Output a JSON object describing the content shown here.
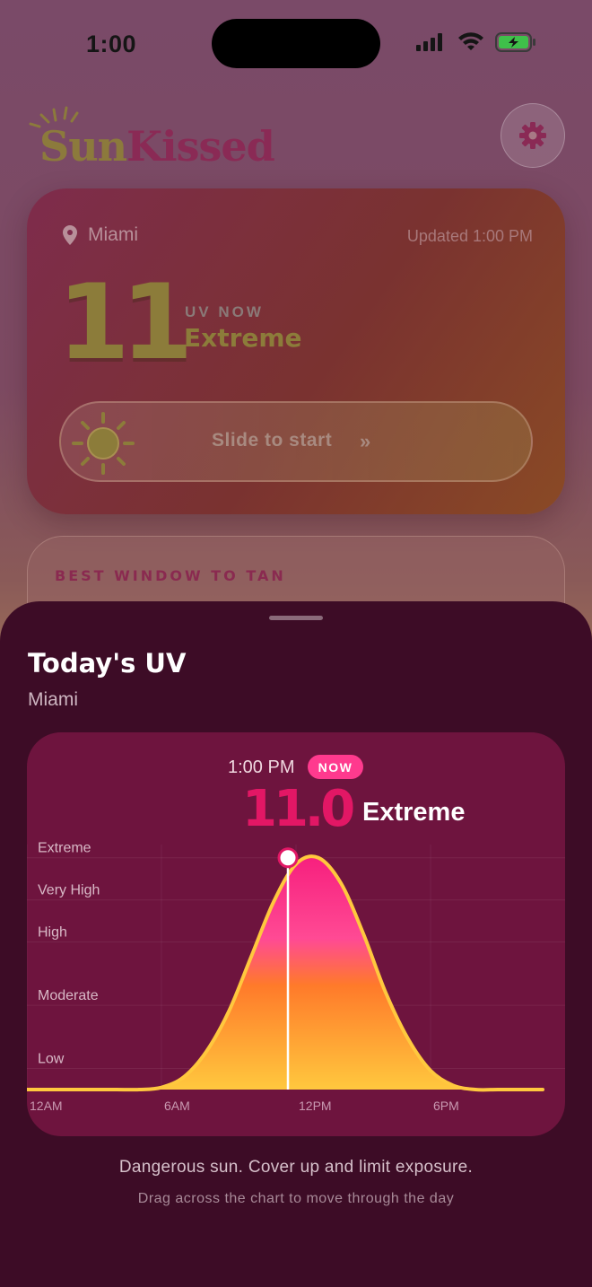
{
  "status_bar": {
    "time": "1:00"
  },
  "app": {
    "logo_sun": "Sun",
    "logo_kissed": "Kissed"
  },
  "uv_card": {
    "location": "Miami",
    "updated": "Updated 1:00 PM",
    "uv_value": "11",
    "uv_now_label": "UV NOW",
    "uv_level": "Extreme",
    "slider_text": "Slide to start"
  },
  "tan_window": {
    "title": "BEST WINDOW TO TAN"
  },
  "sheet": {
    "title": "Today's UV",
    "subtitle": "Miami",
    "selected_time": "1:00 PM",
    "now_badge": "NOW",
    "selected_value": "11.0",
    "selected_level": "Extreme",
    "description": "Dangerous sun. Cover up and limit exposure.",
    "hint": "Drag across the chart to move through the day"
  },
  "colors": {
    "accent_pink": "#ff3a8e",
    "uv_value": "#e21765",
    "sheet_bg": "#3d0c26",
    "chart_bg": "#6e143e"
  },
  "chart_data": {
    "type": "area",
    "x_ticks": [
      "12AM",
      "6AM",
      "12PM",
      "6PM"
    ],
    "y_levels": [
      "Extreme",
      "Very High",
      "High",
      "Moderate",
      "Low"
    ],
    "y_level_values": [
      11,
      9,
      7,
      4,
      1
    ],
    "ylim": [
      0,
      11.5
    ],
    "xlim": [
      0,
      23
    ],
    "x_hours": [
      0,
      1,
      2,
      3,
      4,
      5,
      6,
      7,
      8,
      9,
      10,
      11,
      12,
      13,
      14,
      15,
      16,
      17,
      18,
      19,
      20,
      21,
      22,
      23
    ],
    "values": [
      0,
      0,
      0,
      0,
      0,
      0,
      0.1,
      0.6,
      1.8,
      3.7,
      6.3,
      8.9,
      10.7,
      11.0,
      9.8,
      7.4,
      4.6,
      2.4,
      0.9,
      0.2,
      0,
      0,
      0,
      0
    ],
    "selected_hour": 13,
    "selected_value": 11.0,
    "grid": true
  }
}
